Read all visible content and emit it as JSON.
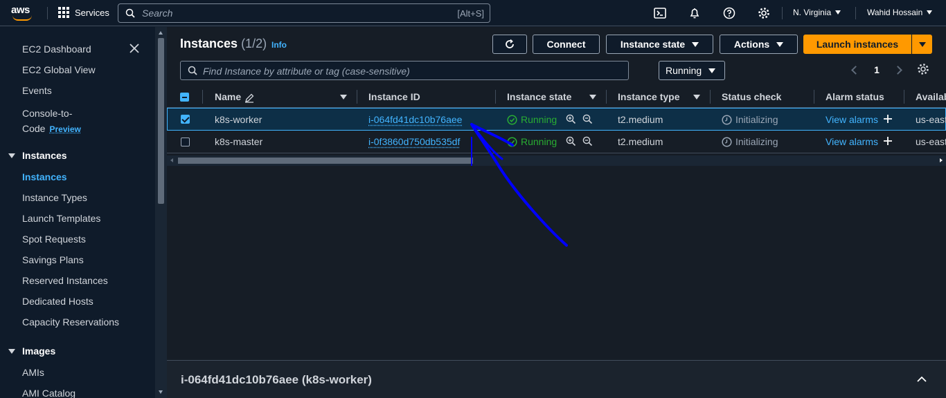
{
  "topnav": {
    "logo_text": "aws",
    "services_label": "Services",
    "search_placeholder": "Search",
    "search_shortcut": "[Alt+S]",
    "region": "N. Virginia",
    "user": "Wahid Hossain"
  },
  "sidebar": {
    "items": [
      {
        "label": "EC2 Dashboard"
      },
      {
        "label": "EC2 Global View"
      },
      {
        "label": "Events"
      },
      {
        "label": "Console-to-Code",
        "line1": "Console-to-",
        "line2": "Code",
        "badge": "Preview"
      }
    ],
    "sections": [
      {
        "title": "Instances",
        "items": [
          "Instances",
          "Instance Types",
          "Launch Templates",
          "Spot Requests",
          "Savings Plans",
          "Reserved Instances",
          "Dedicated Hosts",
          "Capacity Reservations"
        ],
        "active": "Instances"
      },
      {
        "title": "Images",
        "items": [
          "AMIs",
          "AMI Catalog"
        ]
      }
    ]
  },
  "main": {
    "title": "Instances",
    "count": "(1/2)",
    "info": "Info",
    "buttons": {
      "refresh_icon": "refresh-icon",
      "connect": "Connect",
      "instance_state": "Instance state",
      "actions": "Actions",
      "launch": "Launch instances"
    },
    "filter_placeholder": "Find Instance by attribute or tag (case-sensitive)",
    "state_filter": "Running",
    "page": "1",
    "columns": [
      "Name",
      "Instance ID",
      "Instance state",
      "Instance type",
      "Status check",
      "Alarm status",
      "Availab"
    ],
    "rows": [
      {
        "name": "k8s-worker",
        "id": "i-064fd41dc10b76aee",
        "state": "Running",
        "type": "t2.medium",
        "status": "Initializing",
        "alarm": "View alarms",
        "az": "us-east",
        "selected": true
      },
      {
        "name": "k8s-master",
        "id": "i-0f3860d750db535df",
        "state": "Running",
        "type": "t2.medium",
        "status": "Initializing",
        "alarm": "View alarms",
        "az": "us-east",
        "selected": false
      }
    ],
    "detail_title": "i-064fd41dc10b76aee (k8s-worker)"
  },
  "colors": {
    "accent": "#42b4ff",
    "primary": "#ff9900",
    "running": "#29ad32",
    "annotation": "#0000ff"
  }
}
